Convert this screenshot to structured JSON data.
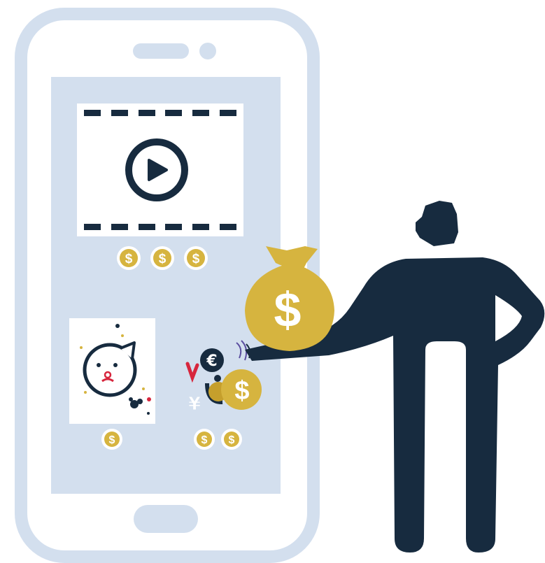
{
  "colors": {
    "phone_frame": "#d3dfee",
    "screen": "#d3dfee",
    "navy": "#172b3f",
    "gold": "#d6b43f",
    "gold_dark": "#c59f2c",
    "white": "#ffffff",
    "red": "#d7263d"
  },
  "currency_symbol": "$",
  "euro_symbol": "€",
  "yen_symbol": "¥",
  "icons": {
    "play": "play-icon",
    "coin": "dollar-coin-icon",
    "bag": "money-bag-icon",
    "character": "sticker-character-icon",
    "currency_cluster": "currency-exchange-icon",
    "person": "person-silhouette-icon"
  },
  "reward_counts": {
    "video": 3,
    "sticker": 1,
    "currency": 2
  }
}
